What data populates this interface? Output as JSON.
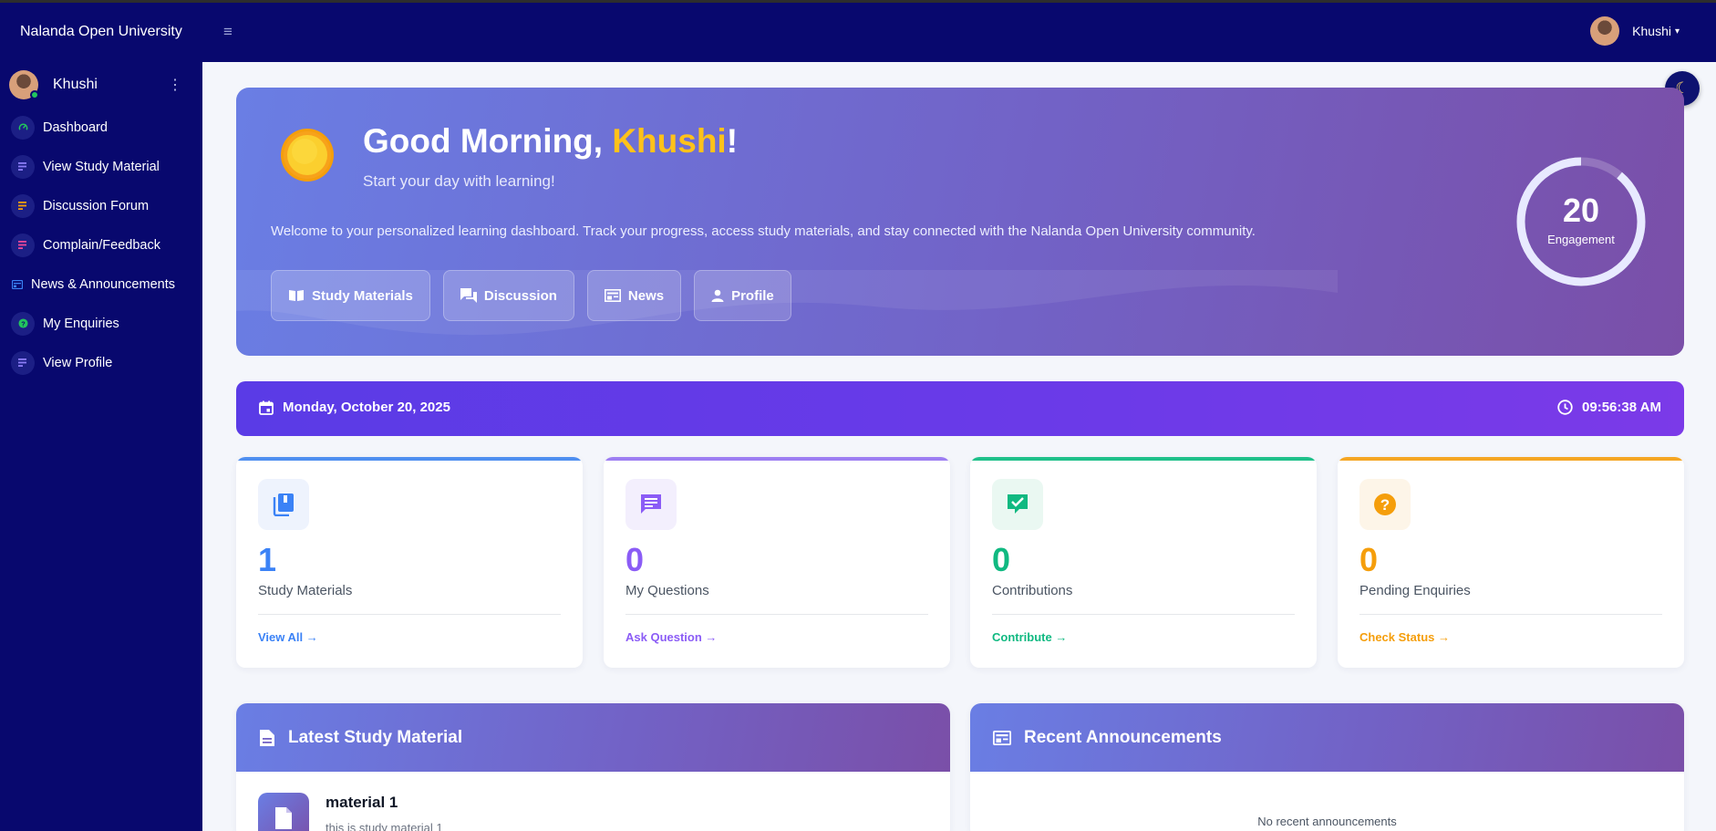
{
  "navbar": {
    "brand": "Nalanda Open University",
    "menu_icon": "hamburger-icon",
    "user_name": "Khushi"
  },
  "sidebar": {
    "user_name": "Khushi",
    "items": [
      {
        "label": "Dashboard",
        "icon": "dashboard-icon",
        "color": "#22c55e"
      },
      {
        "label": "View Study Material",
        "icon": "list-icon",
        "color": "#8b7cf6"
      },
      {
        "label": "Discussion Forum",
        "icon": "forum-icon",
        "color": "#f59e0b"
      },
      {
        "label": "Complain/Feedback",
        "icon": "feedback-icon",
        "color": "#ec4899"
      },
      {
        "label": "News & Announcements",
        "icon": "news-icon",
        "color": "#3b82f6"
      },
      {
        "label": "My Enquiries",
        "icon": "help-icon",
        "color": "#22c55e"
      },
      {
        "label": "View Profile",
        "icon": "list-icon",
        "color": "#8b7cf6"
      }
    ]
  },
  "hero": {
    "greeting_prefix": "Good Morning, ",
    "greeting_name": "Khushi",
    "greeting_suffix": "!",
    "subtitle": "Start your day with learning!",
    "welcome": "Welcome to your personalized learning dashboard. Track your progress, access study materials, and stay connected with the Nalanda Open University community.",
    "buttons": [
      "Study Materials",
      "Discussion",
      "News",
      "Profile"
    ],
    "engagement_value": "20",
    "engagement_label": "Engagement",
    "engagement_fraction": 0.2
  },
  "datebar": {
    "date": "Monday, October 20, 2025",
    "time": "09:56:38 AM"
  },
  "cards": [
    {
      "value": "1",
      "label": "Study Materials",
      "link": "View All",
      "color": "#3b82f6",
      "bg": "#eef3fd",
      "icon": "book-icon"
    },
    {
      "value": "0",
      "label": "My Questions",
      "link": "Ask Question",
      "color": "#8b5cf6",
      "bg": "#f3effd",
      "icon": "chat-icon"
    },
    {
      "value": "0",
      "label": "Contributions",
      "link": "Contribute",
      "color": "#10b981",
      "bg": "#eaf8f2",
      "icon": "check-chat-icon"
    },
    {
      "value": "0",
      "label": "Pending Enquiries",
      "link": "Check Status",
      "color": "#f59e0b",
      "bg": "#fdf5e8",
      "icon": "question-icon"
    }
  ],
  "latest_material": {
    "title": "Latest Study Material",
    "item_title": "material 1",
    "item_desc": "this is study material 1"
  },
  "announcements": {
    "title": "Recent Announcements",
    "empty": "No recent announcements"
  }
}
